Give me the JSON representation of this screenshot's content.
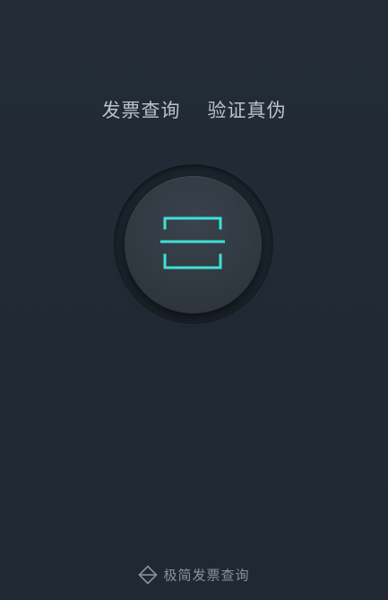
{
  "header": {
    "left_text": "发票查询",
    "right_text": "验证真伪"
  },
  "scan": {
    "icon": "scan-icon",
    "accent_color": "#3fe0d6"
  },
  "footer": {
    "logo_icon": "diamond-logo-icon",
    "brand": "极简发票查询"
  }
}
